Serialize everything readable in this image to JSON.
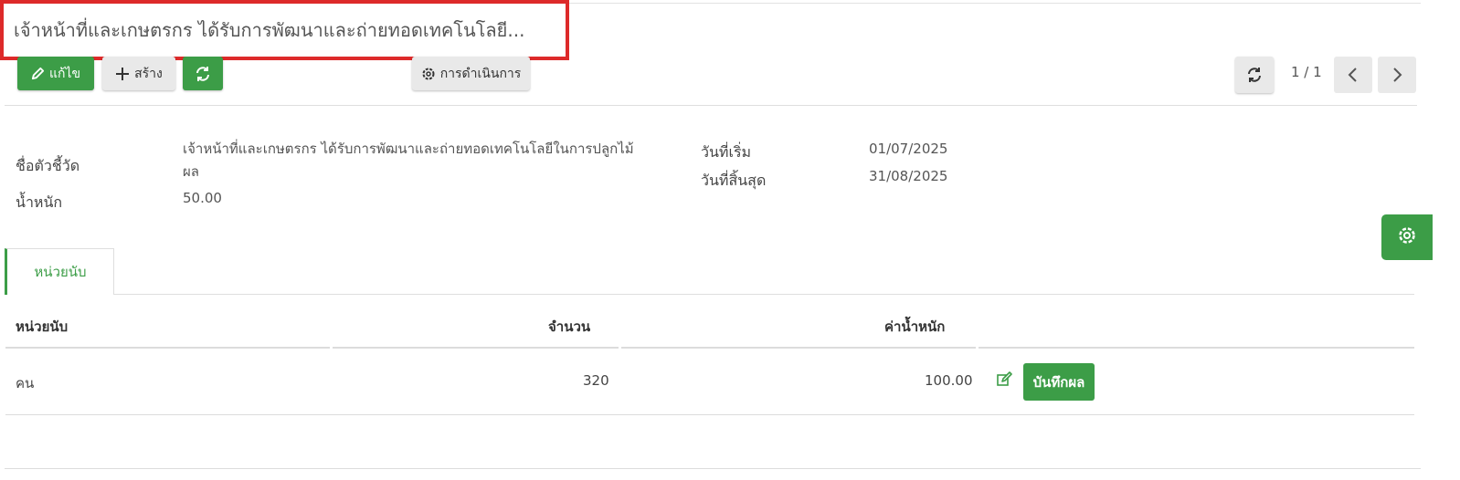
{
  "record": {
    "title": "เจ้าหน้าที่และเกษตรกร ได้รับการพัฒนาและถ่ายทอดเทคโนโลยี..."
  },
  "toolbar": {
    "edit_label": "แก้ไข",
    "create_label": "สร้าง",
    "actions_label": "การดำเนินการ",
    "pager_text": "1 / 1"
  },
  "form": {
    "indicator_name_label": "ชื่อตัวชี้วัด",
    "indicator_name_line1": "เจ้าหน้าที่และเกษตรกร ได้รับการพัฒนาและถ่ายทอดเทคโนโลยีในการปลูกไม้",
    "indicator_name_line2": "ผล",
    "weight_label": "น้ำหนัก",
    "weight_value": "50.00",
    "start_date_label": "วันที่เริ่ม",
    "start_date_value": "01/07/2025",
    "end_date_label": "วันที่สิ้นสุด",
    "end_date_value": "31/08/2025"
  },
  "tabs": [
    {
      "label": "หน่วยนับ",
      "active": true
    }
  ],
  "table": {
    "headers": [
      "หน่วยนับ",
      "จำนวน",
      "ค่าน้ำหนัก"
    ],
    "rows": [
      {
        "unit": "คน",
        "quantity": "320",
        "weight": "100.00",
        "action_label": "บันทึกผล"
      }
    ]
  },
  "colors": {
    "accent": "#3c9d47",
    "highlight_border": "#dd2a2a"
  },
  "icons": [
    "pencil-icon",
    "plus-icon",
    "refresh-icon",
    "gear-icon",
    "chevron-left-icon",
    "chevron-right-icon",
    "edit-icon"
  ]
}
